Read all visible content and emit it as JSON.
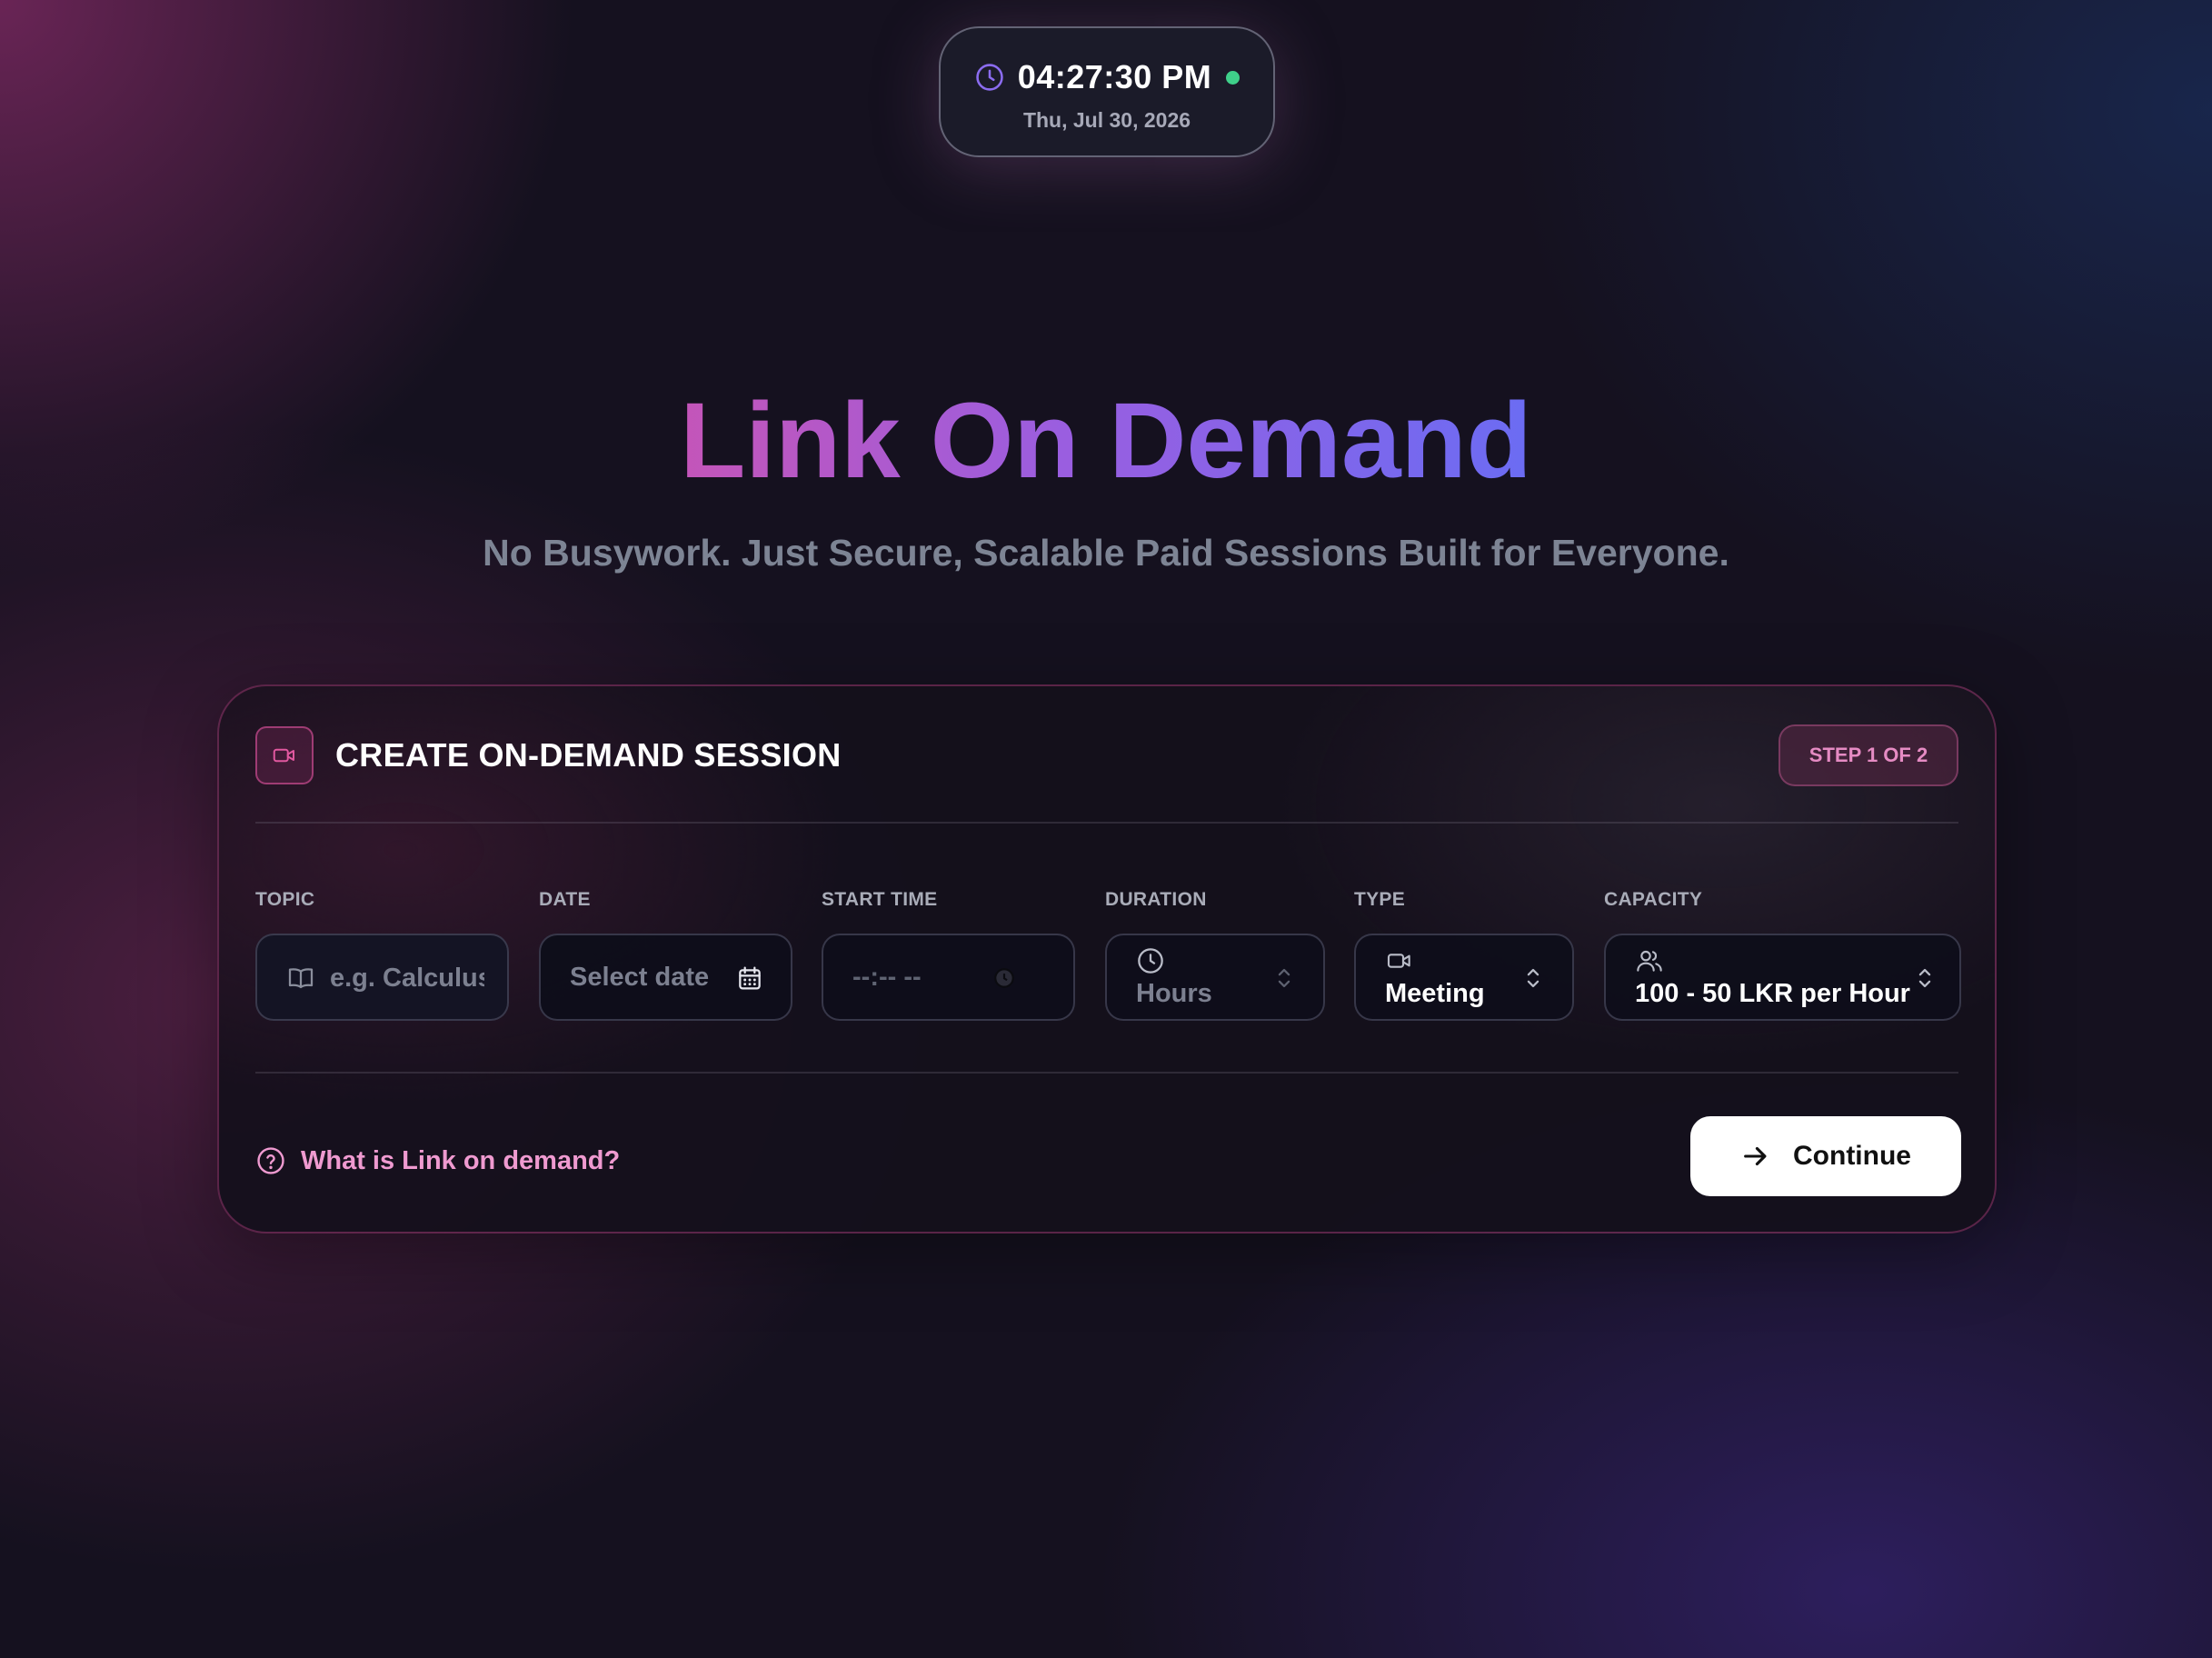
{
  "clock": {
    "time": "04:27:30 PM",
    "date": "Thu, Jul 30, 2026",
    "status_color": "#3fd08a"
  },
  "hero": {
    "title": "Link On Demand",
    "subtitle": "No Busywork. Just Secure, Scalable Paid Sessions Built for Everyone."
  },
  "card": {
    "header_icon": "video-camera-icon",
    "title": "CREATE ON-DEMAND SESSION",
    "step_badge": "STEP 1 OF 2",
    "fields": {
      "topic": {
        "label": "TOPIC",
        "placeholder": "e.g. Calculus",
        "icon": "open-book-icon"
      },
      "date": {
        "label": "DATE",
        "placeholder": "Select date",
        "icon": "calendar-icon"
      },
      "start_time": {
        "label": "START TIME",
        "placeholder": "--:-- --",
        "icon": "clock-icon"
      },
      "duration": {
        "label": "DURATION",
        "placeholder": "Hours",
        "icon": "clock-icon"
      },
      "type": {
        "label": "TYPE",
        "value": "Meeting",
        "icon": "video-camera-icon"
      },
      "capacity": {
        "label": "CAPACITY",
        "value": "100 - 50 LKR per Hour",
        "icon": "users-icon"
      }
    },
    "help_link": "What is Link on demand?",
    "continue_label": "Continue"
  },
  "colors": {
    "accent_pink": "#ef9ad0",
    "title_gradient_start": "#c455b9",
    "title_gradient_end": "#6b6cf3"
  }
}
